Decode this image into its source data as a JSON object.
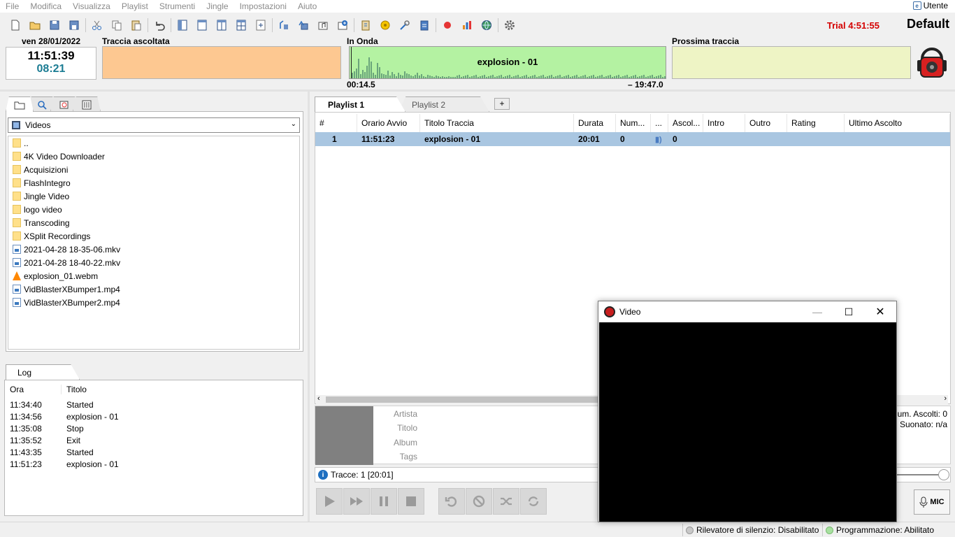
{
  "menu": [
    "File",
    "Modifica",
    "Visualizza",
    "Playlist",
    "Strumenti",
    "Jingle",
    "Impostazioni",
    "Aiuto"
  ],
  "user": "Utente",
  "toolbar_right": {
    "trial": "Trial 4:51:55",
    "profile": "Default"
  },
  "clock": {
    "date": "ven 28/01/2022",
    "time": "11:51:39",
    "elapsed": "08:21"
  },
  "panels": {
    "previous_label": "Traccia ascoltata",
    "onair_label": "In Onda",
    "next_label": "Prossima traccia",
    "onair_title": "explosion - 01",
    "onair_elapsed": "00:14.5",
    "onair_remaining": "– 19:47.0"
  },
  "colors": {
    "previous_bg": "#fdc891",
    "onair_bg": "#b4f2a2",
    "next_bg": "#eef4c5",
    "trial": "#d40000",
    "selected_row": "#a9c6e1"
  },
  "explorer": {
    "folder_selected": "Videos",
    "items": [
      {
        "name": "..",
        "type": "folder"
      },
      {
        "name": "4K Video Downloader",
        "type": "folder"
      },
      {
        "name": "Acquisizioni",
        "type": "folder"
      },
      {
        "name": "FlashIntegro",
        "type": "folder"
      },
      {
        "name": "Jingle Video",
        "type": "folder"
      },
      {
        "name": "logo video",
        "type": "folder"
      },
      {
        "name": "Transcoding",
        "type": "folder"
      },
      {
        "name": "XSplit Recordings",
        "type": "folder"
      },
      {
        "name": "2021-04-28 18-35-06.mkv",
        "type": "video"
      },
      {
        "name": "2021-04-28 18-40-22.mkv",
        "type": "video"
      },
      {
        "name": "explosion_01.webm",
        "type": "vlc"
      },
      {
        "name": "VidBlasterXBumper1.mp4",
        "type": "video"
      },
      {
        "name": "VidBlasterXBumper2.mp4",
        "type": "video"
      }
    ]
  },
  "log": {
    "tab": "Log",
    "col_time": "Ora",
    "col_title": "Titolo",
    "rows": [
      {
        "time": "11:34:40",
        "title": "Started"
      },
      {
        "time": "11:34:56",
        "title": "explosion - 01"
      },
      {
        "time": "11:35:08",
        "title": "Stop"
      },
      {
        "time": "11:35:52",
        "title": "Exit"
      },
      {
        "time": "11:43:35",
        "title": "Started"
      },
      {
        "time": "11:51:23",
        "title": "explosion - 01"
      }
    ]
  },
  "playlist": {
    "tabs": [
      "Playlist 1",
      "Playlist 2"
    ],
    "add_tab": "+",
    "columns": [
      "#",
      "Orario Avvio",
      "Titolo Traccia",
      "Durata",
      "Num...",
      "...",
      "Ascol...",
      "Intro",
      "Outro",
      "Rating",
      "Ultimo Ascolto"
    ],
    "rows": [
      {
        "num": "1",
        "start": "11:51:23",
        "title": "explosion - 01",
        "duration": "20:01",
        "count": "0",
        "plays": "0"
      }
    ]
  },
  "meta": {
    "artist": "Artista",
    "title": "Titolo",
    "album": "Album",
    "tags": "Tags",
    "plays": "Num. Ascolti: 0",
    "played": "Suonato: n/a"
  },
  "status": {
    "tracks": "Tracce: 1 [20:01]",
    "mic": "MIC"
  },
  "bottom": {
    "silence": "Rilevatore di silenzio: Disabilitato",
    "schedule": "Programmazione: Abilitato"
  },
  "video_window": {
    "title": "Video"
  }
}
